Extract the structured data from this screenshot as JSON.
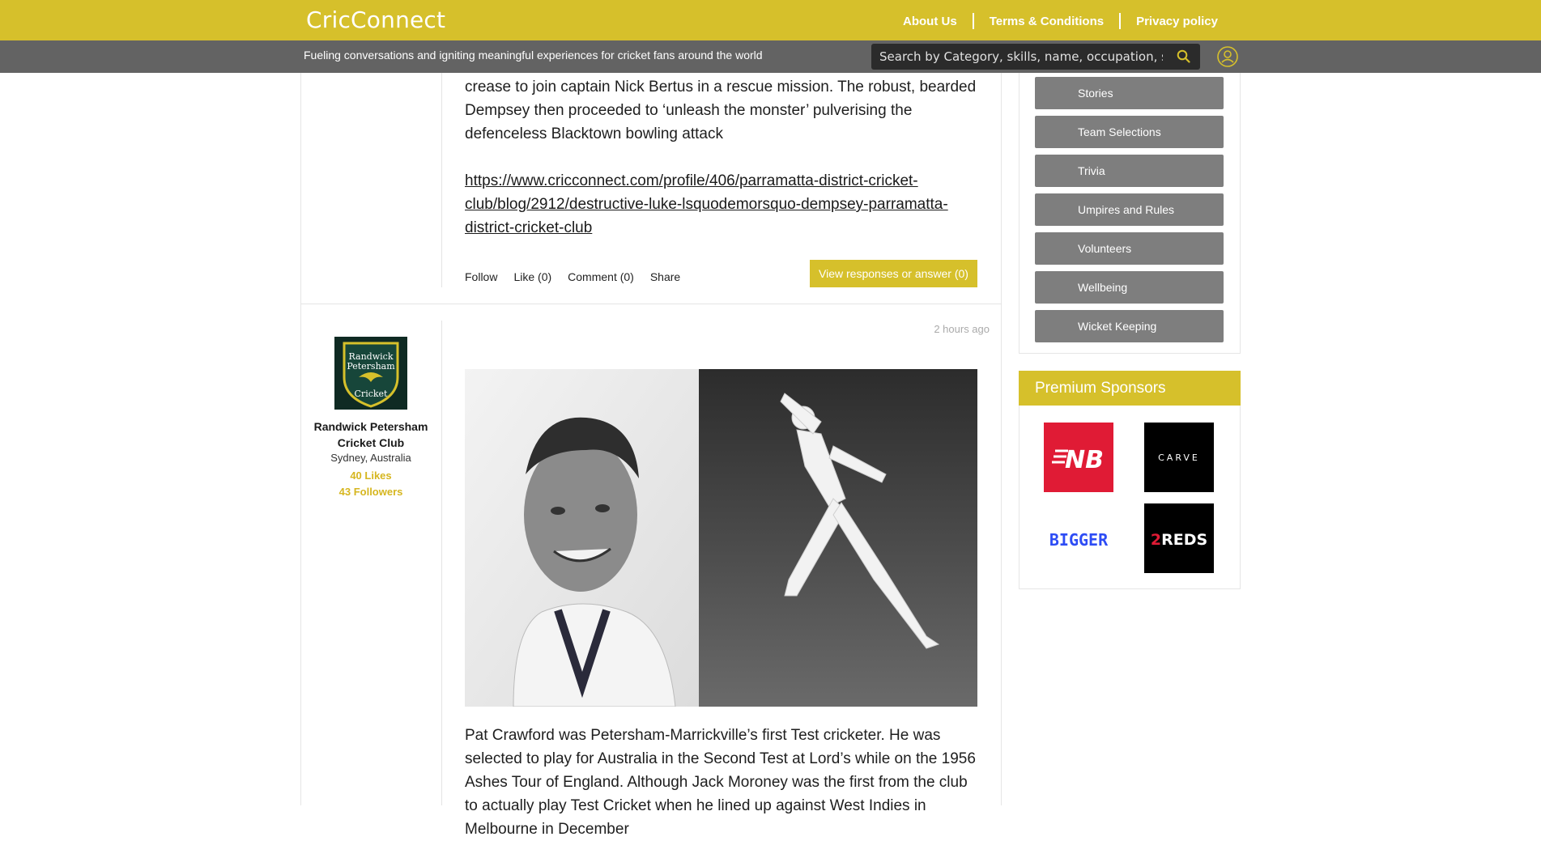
{
  "header": {
    "logo": "CricConnect",
    "nav": [
      "About Us",
      "Terms & Conditions",
      "Privacy policy"
    ],
    "tagline": "Fueling conversations and igniting meaningful experiences for cricket fans around the world",
    "search_placeholder": "Search by Category, skills, name, occupation, suburb"
  },
  "post1": {
    "text": "crease to join captain Nick Bertus in a rescue mission. The robust, bearded Dempsey then proceeded to ‘unleash the monster’ pulverising the defenceless Blacktown bowling attack",
    "link": "https://www.cricconnect.com/profile/406/parramatta-district-cricket-club/blog/2912/destructive-luke-lsquodemorsquo-dempsey-parramatta-district-cricket-club",
    "actions": {
      "follow": "Follow",
      "like": "Like (0)",
      "comment": "Comment (0)",
      "share": "Share"
    },
    "respond_button": "View responses or answer (0)"
  },
  "post2": {
    "timestamp": "2 hours ago",
    "club": {
      "logo_text": "Randwick Petersham Cricket",
      "name": "Randwick Petersham Cricket Club",
      "location": "Sydney, Australia",
      "likes": "40 Likes",
      "followers": "43 Followers"
    },
    "text": "Pat Crawford was Petersham-Marrickville’s first Test cricketer. He was selected to play for Australia in the Second Test at Lord’s while on the 1956 Ashes Tour of England. Although Jack Moroney was the first from the club to actually play Test Cricket when he lined up against West Indies in Melbourne in December"
  },
  "categories": [
    "Stories",
    "Team Selections",
    "Trivia",
    "Umpires and Rules",
    "Volunteers",
    "Wellbeing",
    "Wicket Keeping"
  ],
  "sponsors": {
    "title": "Premium Sponsors",
    "items": [
      {
        "name": "New Balance",
        "text": "NB",
        "bg": "#e01b35"
      },
      {
        "name": "Carve",
        "text": "CARVE",
        "bg": "#000000"
      },
      {
        "name": "Bigger",
        "text": "BIGGER",
        "bg": "#ffffff"
      },
      {
        "name": "2 Reds",
        "text": "2REDS",
        "bg": "#000000"
      }
    ]
  },
  "colors": {
    "brand": "#d6c02b",
    "subbar": "#636363",
    "category": "#7e7e7e"
  }
}
